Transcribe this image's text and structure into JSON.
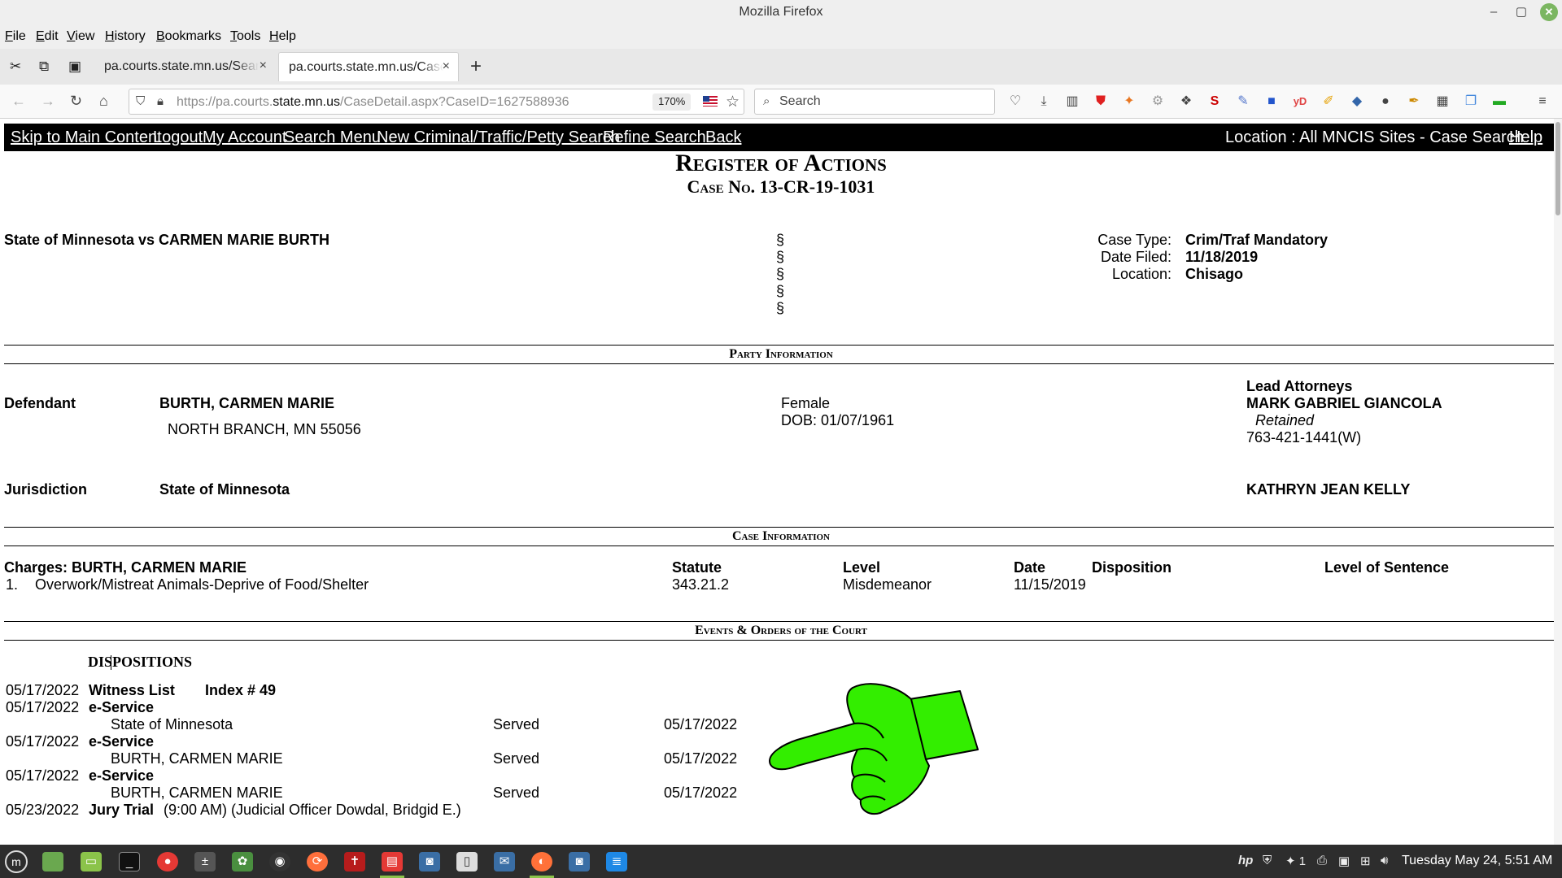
{
  "window": {
    "title": "Mozilla Firefox",
    "minimize": "–",
    "restore": "▢",
    "close": "✕"
  },
  "menubar": [
    "File",
    "Edit",
    "View",
    "History",
    "Bookmarks",
    "Tools",
    "Help"
  ],
  "tabs": [
    {
      "label": "pa.courts.state.mn.us/Search",
      "active": false
    },
    {
      "label": "pa.courts.state.mn.us/CaseDetail",
      "active": true
    }
  ],
  "tab_close": "×",
  "new_tab": "+",
  "url": {
    "prefix": "https://pa.courts.",
    "domain": "state.mn.us",
    "path": "/CaseDetail.aspx?CaseID=1627588936"
  },
  "zoom": "170%",
  "search": {
    "placeholder": "Search"
  },
  "site_nav": {
    "links": [
      "Skip to Main Content",
      "Logout",
      "My Account",
      "Search Menu",
      "New Criminal/Traffic/Petty Search",
      "Refine Search",
      "Back"
    ],
    "location": "Location : All MNCIS Sites - Case Search",
    "help": "Help"
  },
  "register": {
    "title": "Register of Actions",
    "case_no": "Case No. 13-CR-19-1031"
  },
  "case": {
    "style": "State of Minnesota vs CARMEN MARIE BURTH",
    "section_mark": "§",
    "fields": [
      {
        "label": "Case Type:",
        "value": "Crim/Traf Mandatory"
      },
      {
        "label": "Date Filed:",
        "value": "11/18/2019"
      },
      {
        "label": "Location:",
        "value": "Chisago"
      }
    ]
  },
  "party_info": {
    "heading": "Party Information",
    "defendant_label": "Defendant",
    "defendant_name": "BURTH, CARMEN MARIE",
    "defendant_address": "NORTH BRANCH, MN 55056",
    "gender": "Female",
    "dob": "DOB: 01/07/1961",
    "lead_attorneys_label": "Lead Attorneys",
    "attorney_name": "MARK GABRIEL GIANCOLA",
    "attorney_status": "Retained",
    "attorney_phone": "763-421-1441(W)",
    "jurisdiction_label": "Jurisdiction",
    "jurisdiction_name": "State of Minnesota",
    "jurisdiction_attorney": "KATHRYN JEAN KELLY"
  },
  "case_info": {
    "heading": "Case Information",
    "charges_label": "Charges: BURTH, CARMEN MARIE",
    "columns": {
      "statute": "Statute",
      "level": "Level",
      "date": "Date",
      "disposition": "Disposition",
      "sentence": "Level of Sentence"
    },
    "charge": {
      "num": "1.",
      "desc": "Overwork/Mistreat Animals-Deprive of Food/Shelter",
      "statute": "343.21.2",
      "level": "Misdemeanor",
      "date": "11/15/2019"
    }
  },
  "events": {
    "heading": "Events & Orders of the Court",
    "dispositions_label": "DISPOSITIONS",
    "witness": {
      "date": "05/17/2022",
      "type": "Witness List",
      "index": "Index # 49"
    },
    "services": [
      {
        "date": "05/17/2022",
        "type": "e-Service",
        "party": "State of Minnesota",
        "status": "Served",
        "served_date": "05/17/2022"
      },
      {
        "date": "05/17/2022",
        "type": "e-Service",
        "party": "BURTH, CARMEN MARIE",
        "status": "Served",
        "served_date": "05/17/2022"
      },
      {
        "date": "05/17/2022",
        "type": "e-Service",
        "party": "BURTH, CARMEN MARIE",
        "status": "Served",
        "served_date": "05/17/2022"
      }
    ],
    "trial": {
      "date": "05/23/2022",
      "type": "Jury Trial",
      "detail": "(9:00 AM) (Judicial Officer Dowdal, Bridgid E.)"
    }
  },
  "tray": {
    "workspace": "1",
    "clock": "Tuesday May 24,  5:51 AM"
  },
  "colors": {
    "pointer_hand": "#33ee00",
    "site_nav_bg": "#000000",
    "taskbar_bg": "#2d2d2d"
  }
}
